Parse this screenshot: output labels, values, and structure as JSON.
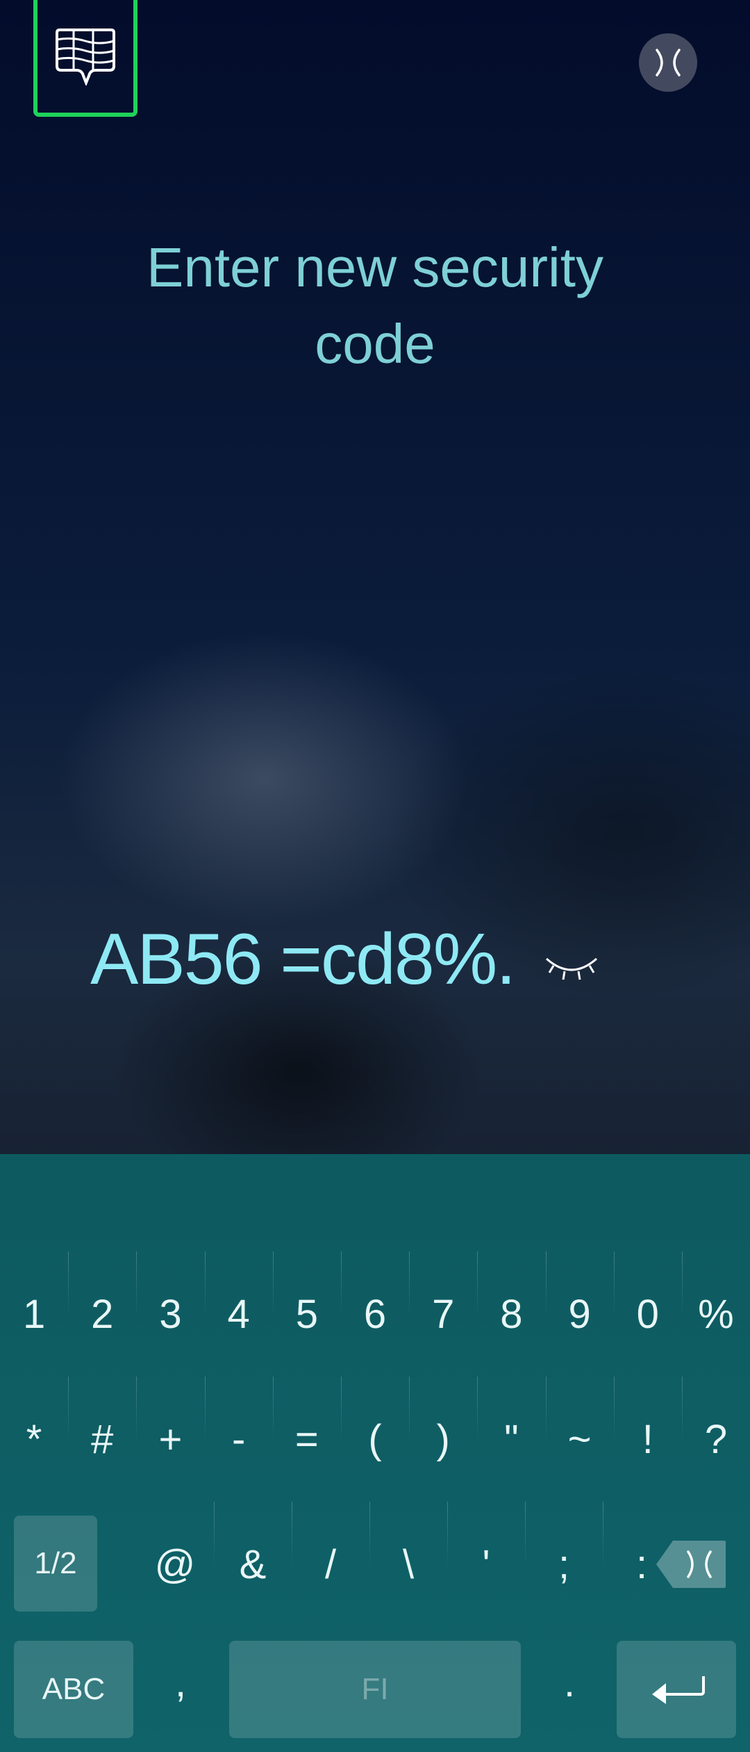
{
  "header": {
    "keyboard_button_icon": "keypad-icon",
    "close_button_icon": "close-icon"
  },
  "title": "Enter new security code",
  "code": {
    "value": "AB56 =cd8%.",
    "visibility_icon": "eye-closed-icon"
  },
  "keyboard": {
    "row1": [
      "1",
      "2",
      "3",
      "4",
      "5",
      "6",
      "7",
      "8",
      "9",
      "0",
      "%"
    ],
    "row2": [
      "*",
      "#",
      "+",
      "-",
      "=",
      "(",
      ")",
      "\"",
      "~",
      "!",
      "?"
    ],
    "row3": [
      "@",
      "&",
      "/",
      "\\",
      "'",
      ";",
      ":"
    ],
    "page_label": "1/2",
    "abc_label": "ABC",
    "comma_label": ",",
    "space_label": "FI",
    "period_label": ".",
    "backspace_icon": "backspace-icon",
    "enter_icon": "enter-icon"
  },
  "colors": {
    "title": "#7ed0d6",
    "code": "#8ee9f4",
    "keyboard_bg": "#0f6369",
    "highlight": "#1fd15a"
  }
}
